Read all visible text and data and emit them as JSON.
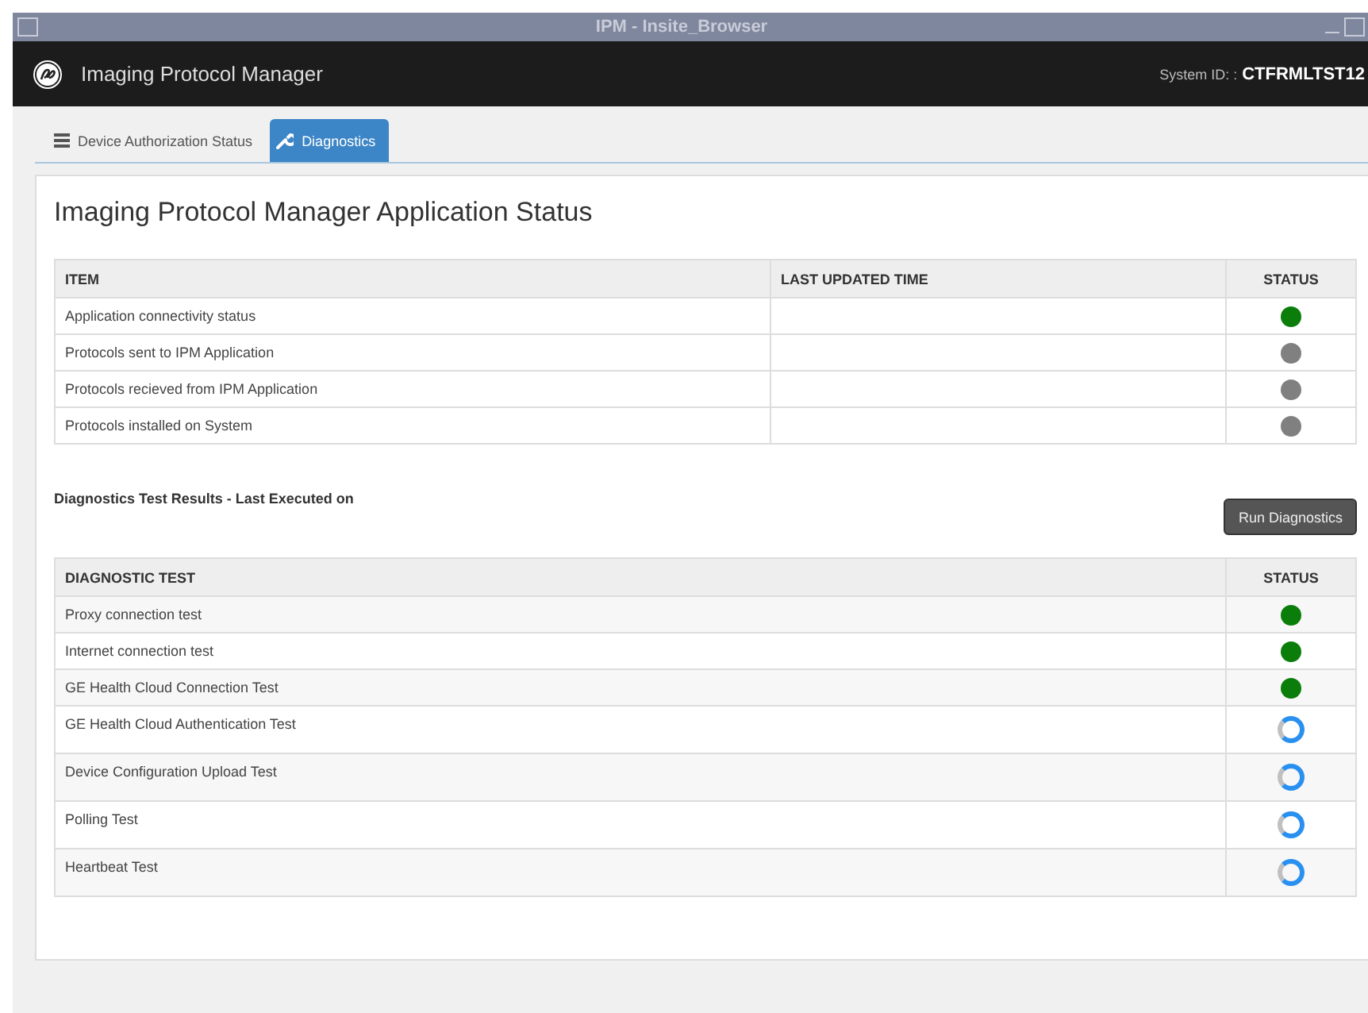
{
  "window": {
    "title": "IPM - Insite_Browser"
  },
  "header": {
    "app_name": "Imaging Protocol Manager",
    "system_label": "System ID: :",
    "system_id": "CTFRMLTST12"
  },
  "tabs": [
    {
      "label": "Device Authorization Status",
      "selected": false
    },
    {
      "label": "Diagnostics",
      "selected": true
    }
  ],
  "status_section": {
    "title": "Imaging Protocol Manager Application Status",
    "columns": [
      "ITEM",
      "LAST UPDATED TIME",
      "STATUS"
    ],
    "rows": [
      {
        "item": "Application connectivity status",
        "kind": "ok"
      },
      {
        "item": "Protocols sent to IPM Application",
        "kind": "idle"
      },
      {
        "item": "Protocols recieved from IPM Application",
        "kind": "idle"
      },
      {
        "item": "Protocols installed on System",
        "kind": "idle"
      }
    ]
  },
  "diagnostics_section": {
    "title": "Diagnostics Test Results - Last Executed on",
    "button": "Run Diagnostics",
    "columns": [
      "DIAGNOSTIC TEST",
      "STATUS"
    ],
    "rows": [
      {
        "test": "Proxy connection test",
        "kind": "ok"
      },
      {
        "test": "Internet connection test",
        "kind": "ok"
      },
      {
        "test": "GE Health Cloud Connection Test",
        "kind": "ok"
      },
      {
        "test": "GE Health Cloud Authentication Test",
        "kind": "running"
      },
      {
        "test": "Device Configuration Upload Test",
        "kind": "running"
      },
      {
        "test": "Polling Test",
        "kind": "running"
      },
      {
        "test": "Heartbeat Test",
        "kind": "running"
      }
    ]
  }
}
